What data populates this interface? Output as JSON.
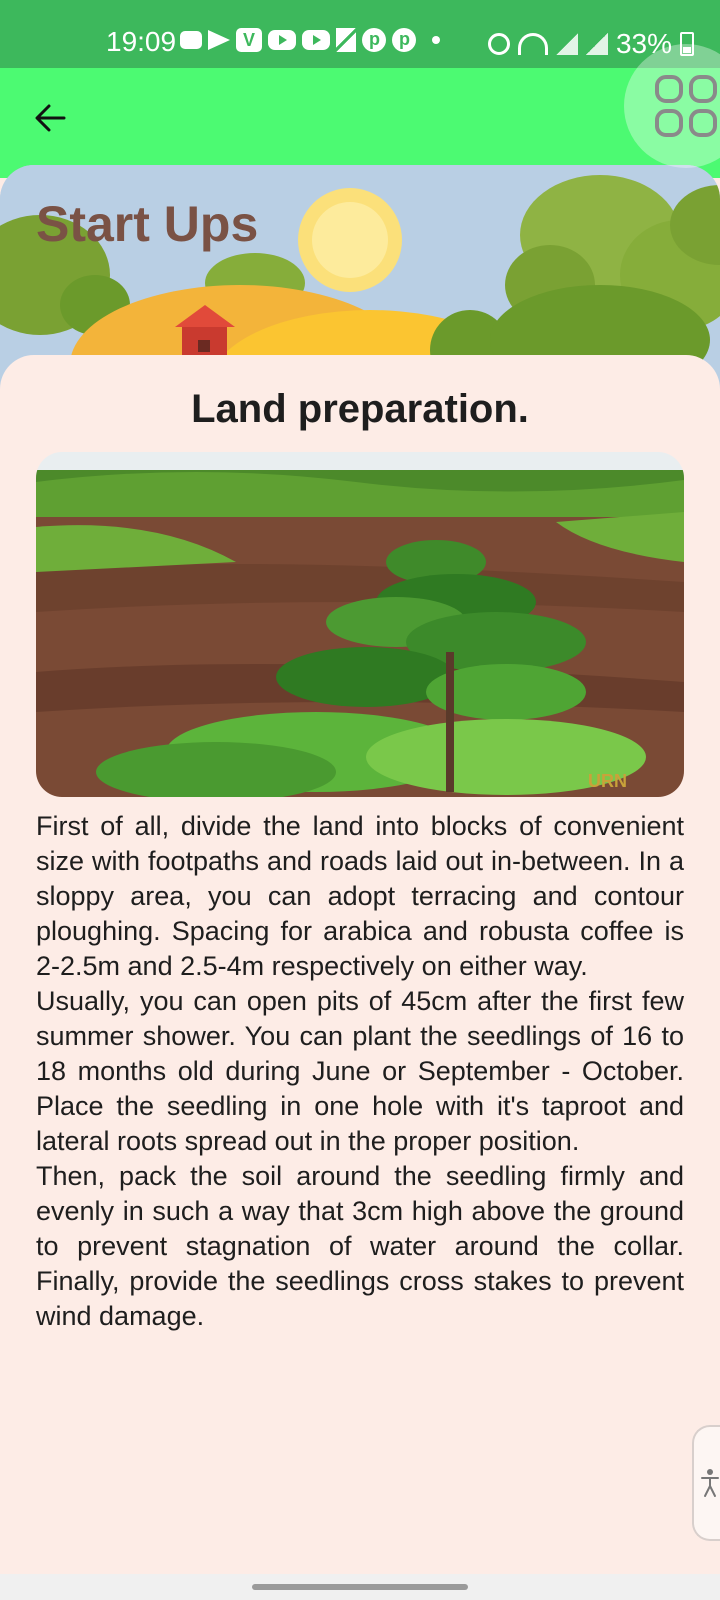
{
  "status_bar": {
    "time": "19:09",
    "battery": "33%",
    "icons": [
      "message-icon",
      "telegram-icon",
      "v-app-icon",
      "youtube-icon",
      "youtube-icon",
      "hourglass-icon",
      "pinterest-icon",
      "pinterest-icon",
      "dot-icon",
      "alarm-icon",
      "wifi-icon",
      "signal-icon",
      "signal-icon",
      "battery-icon"
    ]
  },
  "app_bar": {
    "back_icon": "arrow-left-icon",
    "menu_icon": "grid-icon"
  },
  "banner": {
    "title": "Start Ups"
  },
  "article": {
    "title": "Land preparation.",
    "image_alt": "Coffee seedlings planted in a row on prepared soil",
    "image_watermark": "URN",
    "paragraphs": [
      "First of all, divide the land into blocks of convenient size with footpaths and roads laid out in-between. In a sloppy area, you can adopt terracing and contour ploughing. Spacing for arabica and robusta coffee is 2-2.5m and 2.5-4m respectively on either way.",
      "Usually, you can open pits of 45cm after the first few summer shower. You can plant the seedlings of 16 to 18 months old during June or September - October. Place the seedling in one hole with it's taproot and lateral roots spread out in the proper position.",
      "Then, pack the soil around the seedling firmly and evenly in such a way that 3cm high above the ground to prevent stagnation of water around the collar. Finally, provide the seedlings cross stakes to prevent wind damage."
    ]
  },
  "accessibility": {
    "icon": "accessibility-icon"
  },
  "colors": {
    "status_bar": "#3db85c",
    "app_bar": "#4cfa72",
    "card_background": "#fdece6",
    "banner_title": "#7a5245"
  }
}
